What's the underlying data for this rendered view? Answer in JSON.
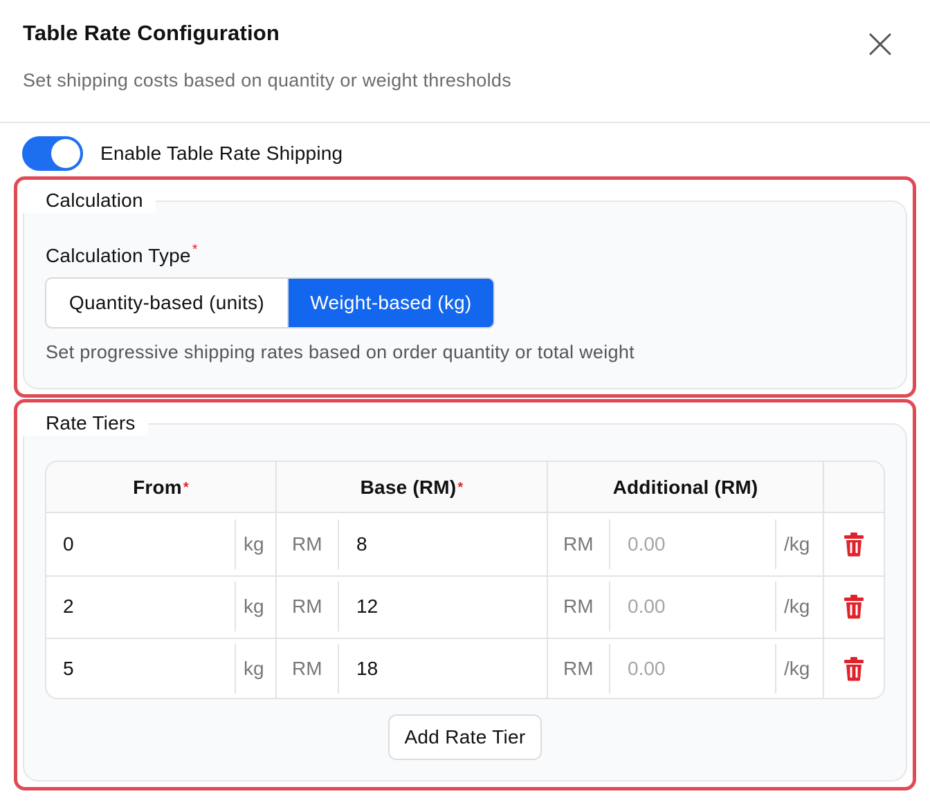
{
  "dialog": {
    "title": "Table Rate Configuration",
    "subtitle": "Set shipping costs based on quantity or weight thresholds",
    "close_icon": "close-icon"
  },
  "toggle": {
    "label": "Enable Table Rate Shipping",
    "enabled": true,
    "color": "#1e6ff0"
  },
  "calculation": {
    "legend": "Calculation",
    "field_label": "Calculation Type",
    "required_mark": "*",
    "options": [
      "Quantity-based (units)",
      "Weight-based (kg)"
    ],
    "selected": "Weight-based (kg)",
    "helper": "Set progressive shipping rates based on order quantity or total weight"
  },
  "tiers": {
    "legend": "Rate Tiers",
    "headers": {
      "from": "From",
      "base": "Base (RM)",
      "additional": "Additional (RM)",
      "required_mark": "*"
    },
    "rows": [
      {
        "from": "0",
        "from_unit": "kg",
        "base_prefix": "RM",
        "base": "8",
        "add_prefix": "RM",
        "add_placeholder": "0.00",
        "add_suffix": "/kg"
      },
      {
        "from": "2",
        "from_unit": "kg",
        "base_prefix": "RM",
        "base": "12",
        "add_prefix": "RM",
        "add_placeholder": "0.00",
        "add_suffix": "/kg"
      },
      {
        "from": "5",
        "from_unit": "kg",
        "base_prefix": "RM",
        "base": "18",
        "add_prefix": "RM",
        "add_placeholder": "0.00",
        "add_suffix": "/kg"
      }
    ],
    "delete_icon": "trash-icon",
    "add_button": "Add Rate Tier"
  },
  "colors": {
    "accent": "#1366ee",
    "highlight_border": "#e04a55",
    "danger": "#e0222b"
  }
}
